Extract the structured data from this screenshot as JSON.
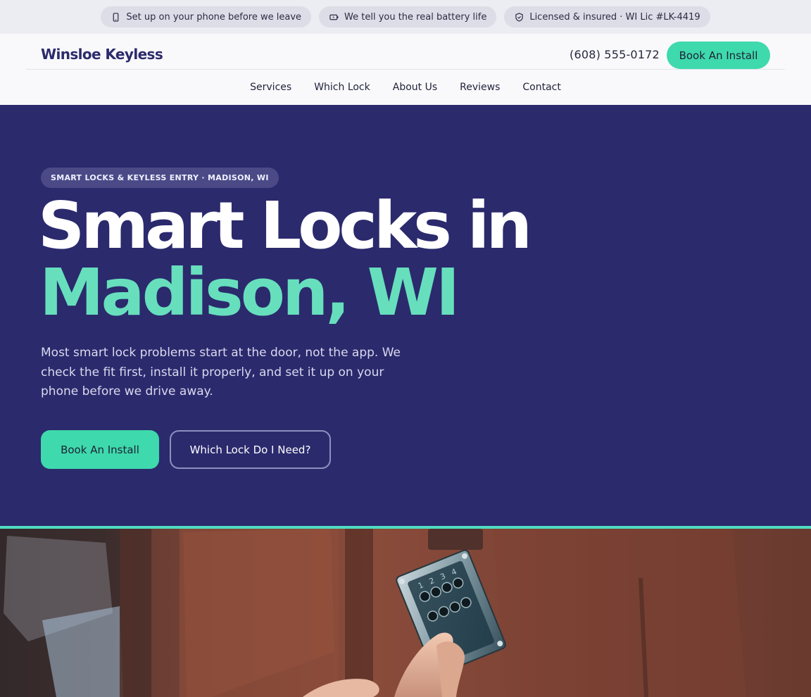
{
  "topbar": {
    "items": [
      {
        "label": "Set up on your phone before we leave",
        "icon": "phone-icon"
      },
      {
        "label": "We tell you the real battery life",
        "icon": "battery-icon"
      },
      {
        "label": "Licensed & insured · WI Lic #LK-4419",
        "icon": "shield-icon"
      }
    ]
  },
  "header": {
    "brand": "Winsloe Keyless",
    "phone": "(608) 555-0172",
    "cta": "Book An Install",
    "nav": [
      "Services",
      "Which Lock",
      "About Us",
      "Reviews",
      "Contact"
    ]
  },
  "hero": {
    "tag": "SMART LOCKS & KEYLESS ENTRY · MADISON, WI",
    "title_line1": "Smart Locks in",
    "title_line2": "Madison, WI",
    "lead": "Most smart lock problems start at the door, not the app. We check the fit first, install it properly, and set it up on your phone before we drive away.",
    "primary_cta": "Book An Install",
    "secondary_cta": "Which Lock Do I Need?"
  },
  "colors": {
    "navy": "#2b2a6d",
    "accent": "#3ed9ac",
    "accent_text": "#67dfbd"
  }
}
